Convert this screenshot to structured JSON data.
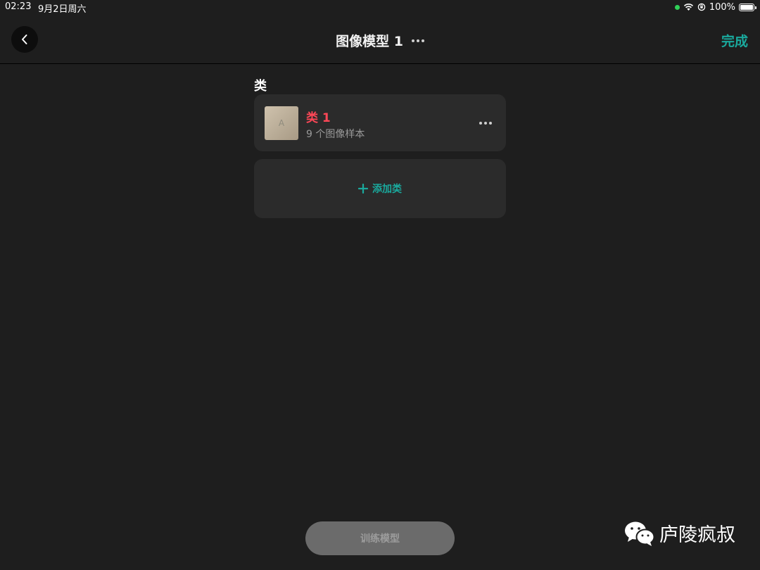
{
  "status_bar": {
    "time": "02:23",
    "date": "9月2日周六",
    "battery": "100%",
    "battery_level": 1.0
  },
  "nav": {
    "title": "图像模型 1",
    "done_label": "完成",
    "back_icon": "chevron-left-icon",
    "more_icon": "ellipsis-icon"
  },
  "section": {
    "label": "类"
  },
  "classes": [
    {
      "name": "类 1",
      "sample_count": "9 个图像样本",
      "thumb_letter": "A"
    }
  ],
  "add_class": {
    "label": "添加类",
    "icon": "plus-icon"
  },
  "train_button": {
    "label": "训练模型"
  },
  "watermark": {
    "text": "庐陵疯叔",
    "icon": "wechat-icon"
  },
  "colors": {
    "accent": "#1aa99d",
    "class_name": "#ff4757",
    "background": "#1e1e1e",
    "card": "#2b2b2b"
  }
}
